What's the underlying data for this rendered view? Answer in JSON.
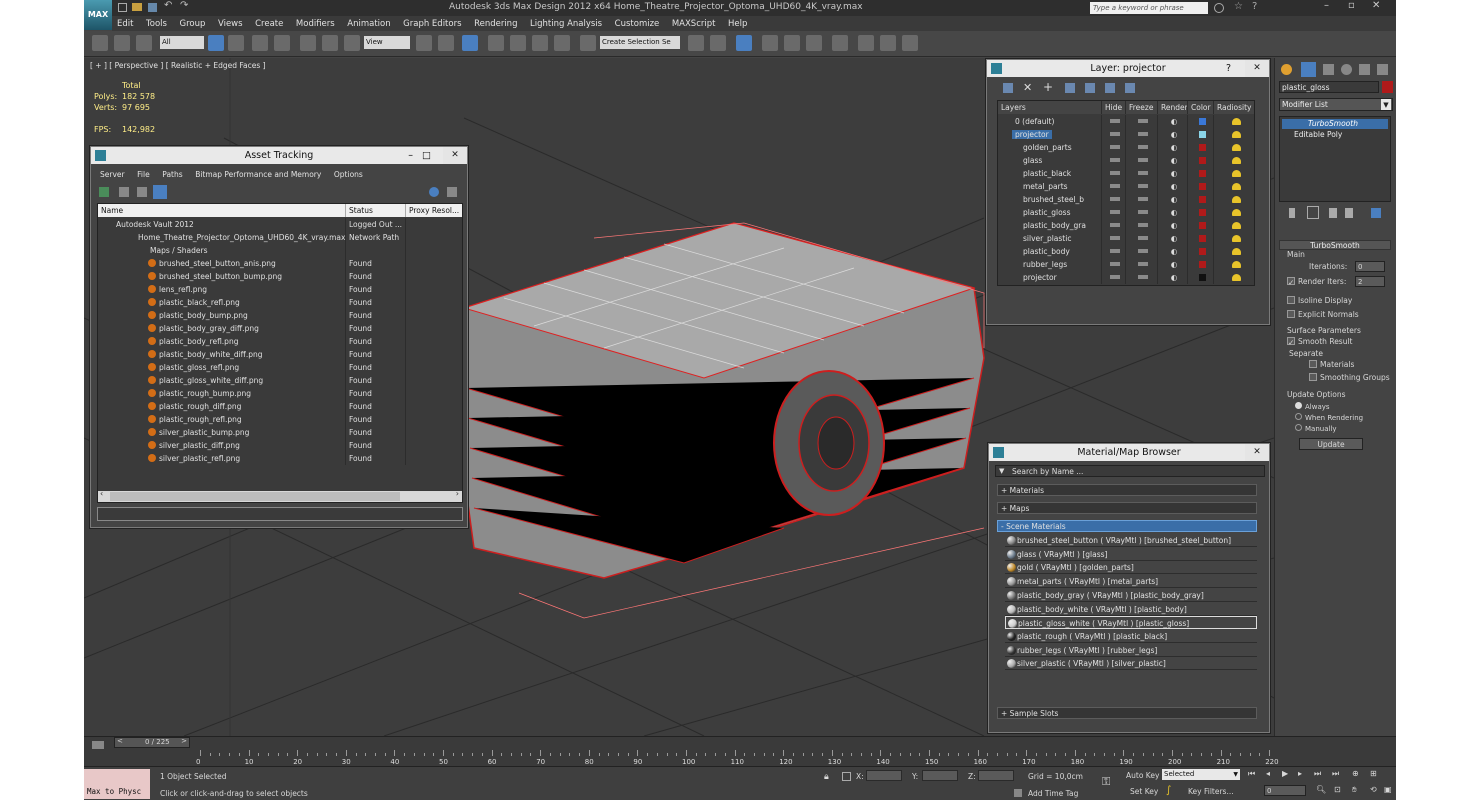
{
  "app": {
    "logo_text": "MAX",
    "title": "Autodesk 3ds Max Design 2012 x64     Home_Theatre_Projector_Optoma_UHD60_4K_vray.max",
    "search_placeholder": "Type a keyword or phrase",
    "menu": [
      "Edit",
      "Tools",
      "Group",
      "Views",
      "Create",
      "Modifiers",
      "Animation",
      "Graph Editors",
      "Rendering",
      "Lighting Analysis",
      "Customize",
      "MAXScript",
      "Help"
    ],
    "selection_filter": "All",
    "ref_coord": "View",
    "named_selection": "Create Selection Se"
  },
  "viewport": {
    "label": "[ + ] [ Perspective ] [ Realistic + Edged Faces ]",
    "stats_header": "Total",
    "polys_label": "Polys:",
    "polys_value": "182 578",
    "verts_label": "Verts:",
    "verts_value": "97 695",
    "fps_label": "FPS:",
    "fps_value": "142,982"
  },
  "asset_tracking": {
    "title": "Asset Tracking",
    "menu": [
      "Server",
      "File",
      "Paths",
      "Bitmap Performance and Memory",
      "Options"
    ],
    "columns": [
      "Name",
      "Status",
      "Proxy Resol..."
    ],
    "vault": {
      "name": "Autodesk Vault 2012",
      "status": "Logged Out ..."
    },
    "scene_file": {
      "name": "Home_Theatre_Projector_Optoma_UHD60_4K_vray.max",
      "status": "Network Path"
    },
    "group": "Maps / Shaders",
    "files": [
      {
        "name": "brushed_steel_button_anis.png",
        "status": "Found"
      },
      {
        "name": "brushed_steel_button_bump.png",
        "status": "Found"
      },
      {
        "name": "lens_refl.png",
        "status": "Found"
      },
      {
        "name": "plastic_black_refl.png",
        "status": "Found"
      },
      {
        "name": "plastic_body_bump.png",
        "status": "Found"
      },
      {
        "name": "plastic_body_gray_diff.png",
        "status": "Found"
      },
      {
        "name": "plastic_body_refl.png",
        "status": "Found"
      },
      {
        "name": "plastic_body_white_diff.png",
        "status": "Found"
      },
      {
        "name": "plastic_gloss_refl.png",
        "status": "Found"
      },
      {
        "name": "plastic_gloss_white_diff.png",
        "status": "Found"
      },
      {
        "name": "plastic_rough_bump.png",
        "status": "Found"
      },
      {
        "name": "plastic_rough_diff.png",
        "status": "Found"
      },
      {
        "name": "plastic_rough_refl.png",
        "status": "Found"
      },
      {
        "name": "silver_plastic_bump.png",
        "status": "Found"
      },
      {
        "name": "silver_plastic_diff.png",
        "status": "Found"
      },
      {
        "name": "silver_plastic_refl.png",
        "status": "Found"
      }
    ]
  },
  "layer_window": {
    "title": "Layer: projector",
    "help": "?",
    "columns": [
      "Layers",
      "Hide",
      "Freeze",
      "Render",
      "Color",
      "Radiosity"
    ],
    "layers": [
      {
        "name": "0 (default)",
        "color": "#3a78d8",
        "indent": 1
      },
      {
        "name": "projector",
        "color": "#8ad4e8",
        "indent": 1,
        "selected": true
      },
      {
        "name": "golden_parts",
        "color": "#b01a1a",
        "indent": 2
      },
      {
        "name": "glass",
        "color": "#b01a1a",
        "indent": 2
      },
      {
        "name": "plastic_black",
        "color": "#b01a1a",
        "indent": 2
      },
      {
        "name": "metal_parts",
        "color": "#b01a1a",
        "indent": 2
      },
      {
        "name": "brushed_steel_b",
        "color": "#b01a1a",
        "indent": 2
      },
      {
        "name": "plastic_gloss",
        "color": "#b01a1a",
        "indent": 2
      },
      {
        "name": "plastic_body_gra",
        "color": "#b01a1a",
        "indent": 2
      },
      {
        "name": "silver_plastic",
        "color": "#b01a1a",
        "indent": 2
      },
      {
        "name": "plastic_body",
        "color": "#b01a1a",
        "indent": 2
      },
      {
        "name": "rubber_legs",
        "color": "#b01a1a",
        "indent": 2
      },
      {
        "name": "projector",
        "color": "#111111",
        "indent": 2
      }
    ]
  },
  "material_browser": {
    "title": "Material/Map Browser",
    "search_placeholder": "Search by Name ...",
    "sections": [
      "+ Materials",
      "+ Maps",
      "- Scene Materials",
      "+ Sample Slots"
    ],
    "materials": [
      {
        "label": "brushed_steel_button  ( VRayMtl ) [brushed_steel_button]",
        "sphere": "#888888"
      },
      {
        "label": "glass  ( VRayMtl ) [glass]",
        "sphere": "#6a7a8a"
      },
      {
        "label": "gold  ( VRayMtl ) [golden_parts]",
        "sphere": "#c08a2a"
      },
      {
        "label": "metal_parts  ( VRayMtl ) [metal_parts]",
        "sphere": "#999999"
      },
      {
        "label": "plastic_body_gray  ( VRayMtl ) [plastic_body_gray]",
        "sphere": "#777777"
      },
      {
        "label": "plastic_body_white  ( VRayMtl ) [plastic_body]",
        "sphere": "#bbbbbb"
      },
      {
        "label": "plastic_gloss_white  ( VRayMtl ) [plastic_gloss]",
        "sphere": "#cccccc",
        "selected": true
      },
      {
        "label": "plastic_rough  ( VRayMtl ) [plastic_black]",
        "sphere": "#222222"
      },
      {
        "label": "rubber_legs  ( VRayMtl ) [rubber_legs]",
        "sphere": "#333333"
      },
      {
        "label": "silver_plastic  ( VRayMtl ) [silver_plastic]",
        "sphere": "#aaaaaa"
      }
    ]
  },
  "command_panel": {
    "object_name": "plastic_gloss",
    "modifier_list": "Modifier List",
    "stack": [
      "TurboSmooth",
      "Editable Poly"
    ],
    "rollout_title": "TurboSmooth",
    "main_label": "Main",
    "iterations_label": "Iterations:",
    "iterations_value": "0",
    "render_iters_label": "Render Iters:",
    "render_iters_value": "2",
    "isoline": "Isoline Display",
    "explicit": "Explicit Normals",
    "surface_params": "Surface Parameters",
    "smooth_result": "Smooth Result",
    "separate": "Separate",
    "materials": "Materials",
    "smoothing_groups": "Smoothing Groups",
    "update_options": "Update Options",
    "always": "Always",
    "when_rendering": "When Rendering",
    "manually": "Manually",
    "update_btn": "Update"
  },
  "timeline": {
    "frame_text": "0 / 225",
    "prev": "<",
    "next": ">",
    "ticks": [
      "0",
      "10",
      "20",
      "30",
      "40",
      "50",
      "60",
      "70",
      "80",
      "90",
      "100",
      "110",
      "120",
      "130",
      "140",
      "150",
      "160",
      "170",
      "180",
      "190",
      "200",
      "210",
      "220"
    ]
  },
  "status": {
    "maxscript": "Max to Physc",
    "selected": "1 Object Selected",
    "prompt": "Click or click-and-drag to select objects",
    "x_label": "X:",
    "y_label": "Y:",
    "z_label": "Z:",
    "grid": "Grid = 10,0cm",
    "add_time_tag": "Add Time Tag",
    "auto_key": "Auto Key",
    "set_key": "Set Key",
    "selected_drop": "Selected",
    "key_filters": "Key Filters...",
    "frame_value": "0"
  }
}
